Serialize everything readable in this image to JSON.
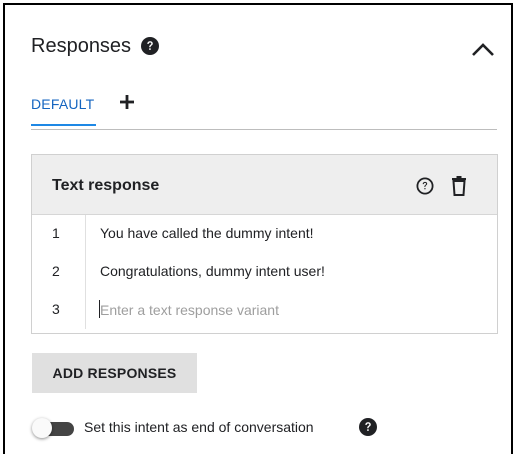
{
  "header": {
    "title": "Responses",
    "help_icon": "help-circle-icon",
    "collapse_icon": "chevron-up-icon"
  },
  "tabs": {
    "default_label": "DEFAULT",
    "add_icon": "plus-icon",
    "active_color": "#1e88e5"
  },
  "text_response_card": {
    "title": "Text response",
    "help_icon": "help-outline-icon",
    "delete_icon": "trash-icon",
    "rows": [
      {
        "num": "1",
        "text": "You have called the dummy intent!"
      },
      {
        "num": "2",
        "text": "Congratulations, dummy intent user!"
      },
      {
        "num": "3",
        "placeholder": "Enter a text response variant"
      }
    ]
  },
  "add_responses_label": "ADD RESPONSES",
  "end_conversation": {
    "label": "Set this intent as end of conversation",
    "enabled": false
  }
}
